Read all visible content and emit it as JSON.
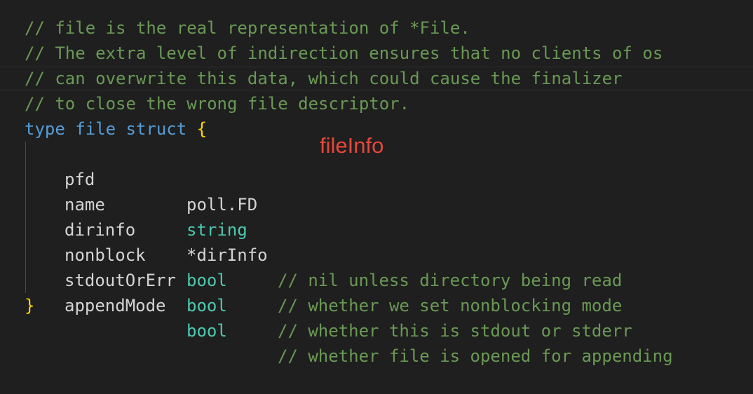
{
  "code": {
    "comments": [
      "// file is the real representation of *File.",
      "// The extra level of indirection ensures that no clients of os",
      "// can overwrite this data, which could cause the finalizer",
      "// to close the wrong file descriptor."
    ],
    "decl": {
      "keyword_type": "type",
      "name": "file",
      "keyword_struct": "struct",
      "open_brace": "{",
      "close_brace": "}"
    },
    "fields": [
      {
        "name": "pfd",
        "type": "poll.FD",
        "comment": ""
      },
      {
        "name": "name",
        "type": "string",
        "comment": ""
      },
      {
        "name": "dirinfo",
        "type": "*dirInfo",
        "comment": "// nil unless directory being read"
      },
      {
        "name": "nonblock",
        "type": "bool",
        "comment": "// whether we set nonblocking mode"
      },
      {
        "name": "stdoutOrErr",
        "type": "bool",
        "comment": "// whether this is stdout or stderr"
      },
      {
        "name": "appendMode",
        "type": "bool",
        "comment": "// whether file is opened for appending"
      }
    ]
  },
  "annotation": {
    "label": "fileInfo",
    "color": "#e8463a"
  },
  "colors": {
    "background": "#1f1f1f",
    "comment": "#6a9955",
    "keyword": "#569cd6",
    "type": "#4ec9b0",
    "brace": "#ffd700"
  }
}
